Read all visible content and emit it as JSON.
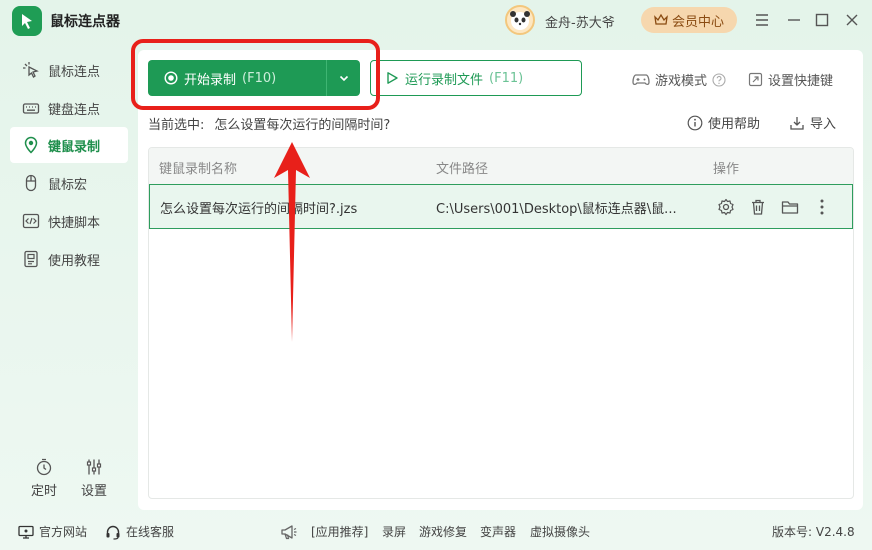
{
  "app": {
    "title": "鼠标连点器"
  },
  "user": {
    "name": "金舟-苏大爷",
    "vip_label": "会员中心"
  },
  "sidebar": {
    "items": [
      {
        "label": "鼠标连点",
        "icon": "cursor-click-icon"
      },
      {
        "label": "键盘连点",
        "icon": "keyboard-icon"
      },
      {
        "label": "键鼠录制",
        "icon": "record-pin-icon",
        "active": true
      },
      {
        "label": "鼠标宏",
        "icon": "mouse-icon"
      },
      {
        "label": "快捷脚本",
        "icon": "code-icon"
      },
      {
        "label": "使用教程",
        "icon": "tutorial-icon"
      }
    ],
    "timer_label": "定时",
    "settings_label": "设置"
  },
  "toolbar": {
    "record_label": "开始录制",
    "record_key": "(F10)",
    "run_label": "运行录制文件",
    "run_key": "(F11)",
    "game_mode": "游戏模式",
    "shortcut": "设置快捷键"
  },
  "current": {
    "prefix": "当前选中:",
    "value": "怎么设置每次运行的间隔时间?"
  },
  "actions": {
    "help": "使用帮助",
    "import": "导入"
  },
  "table": {
    "headers": [
      "键鼠录制名称",
      "文件路径",
      "操作"
    ],
    "rows": [
      {
        "name": "怎么设置每次运行的间隔时间?.jzs",
        "path": "C:\\Users\\001\\Desktop\\鼠标连点器\\鼠..."
      }
    ]
  },
  "footer": {
    "official_site": "官方网站",
    "online_service": "在线客服",
    "recommend": "[应用推荐]",
    "links": [
      "录屏",
      "游戏修复",
      "变声器",
      "虚拟摄像头"
    ],
    "version": "版本号: V2.4.8"
  },
  "colors": {
    "accent": "#1e9a55",
    "highlight": "#e8201a",
    "vip": "#f6d7ae"
  }
}
